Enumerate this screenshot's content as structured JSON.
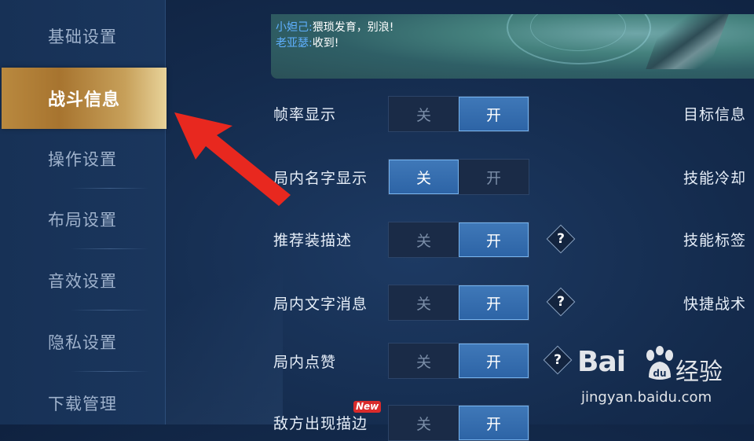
{
  "sidebar": {
    "items": [
      {
        "label": "基础设置",
        "active": false
      },
      {
        "label": "战斗信息",
        "active": true
      },
      {
        "label": "操作设置",
        "active": false
      },
      {
        "label": "布局设置",
        "active": false
      },
      {
        "label": "音效设置",
        "active": false
      },
      {
        "label": "隐私设置",
        "active": false
      },
      {
        "label": "下载管理",
        "active": false
      }
    ]
  },
  "preview": {
    "chat": [
      {
        "name": "小妲己:",
        "message": "猥琐发育，别浪!"
      },
      {
        "name": "老亚瑟:",
        "message": "收到!"
      }
    ]
  },
  "settings": {
    "off_label": "关",
    "on_label": "开",
    "rows": [
      {
        "label": "帧率显示",
        "selected": "开",
        "help": false
      },
      {
        "label": "局内名字显示",
        "selected": "关",
        "help": false
      },
      {
        "label": "推荐装描述",
        "selected": "开",
        "help": true
      },
      {
        "label": "局内文字消息",
        "selected": "开",
        "help": true
      },
      {
        "label": "局内点赞",
        "selected": "开",
        "help": true
      },
      {
        "label": "敌方出现描边",
        "selected": "开",
        "help": false,
        "badge": "New"
      }
    ],
    "help_symbol": "?"
  },
  "right_column": {
    "labels": [
      "目标信息",
      "技能冷却",
      "技能标签",
      "快捷战术"
    ]
  },
  "watermark": {
    "brand": "Bai",
    "brand_cn": "经验",
    "paw": "du",
    "url": "jingyan.baidu.com"
  },
  "colors": {
    "active_tab": "#b9893f",
    "toggle_selected": "#2d64a6",
    "arrow": "#e8281f",
    "chat_name": "#5fb0ff"
  }
}
